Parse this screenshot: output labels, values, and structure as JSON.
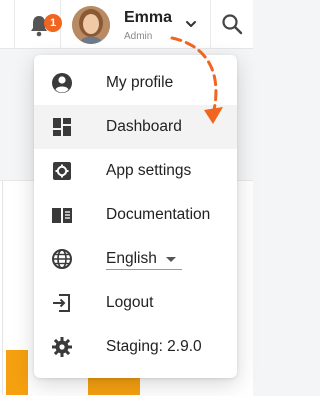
{
  "header": {
    "notifications": {
      "count": "1",
      "icon": "bell-icon"
    },
    "user": {
      "name": "Emma",
      "role": "Admin"
    }
  },
  "menu": {
    "items": [
      {
        "label": "My profile",
        "icon": "user-circle-icon"
      },
      {
        "label": "Dashboard",
        "icon": "dashboard-icon",
        "active": true
      },
      {
        "label": "App settings",
        "icon": "gear-box-icon"
      },
      {
        "label": "Documentation",
        "icon": "book-icon"
      },
      {
        "label": "English",
        "icon": "globe-icon"
      },
      {
        "label": "Logout",
        "icon": "logout-icon"
      },
      {
        "label": "Staging: 2.9.0",
        "icon": "cog-icon"
      }
    ]
  },
  "colors": {
    "accent": "#f0651f",
    "chart_bar": "#f5a010"
  }
}
